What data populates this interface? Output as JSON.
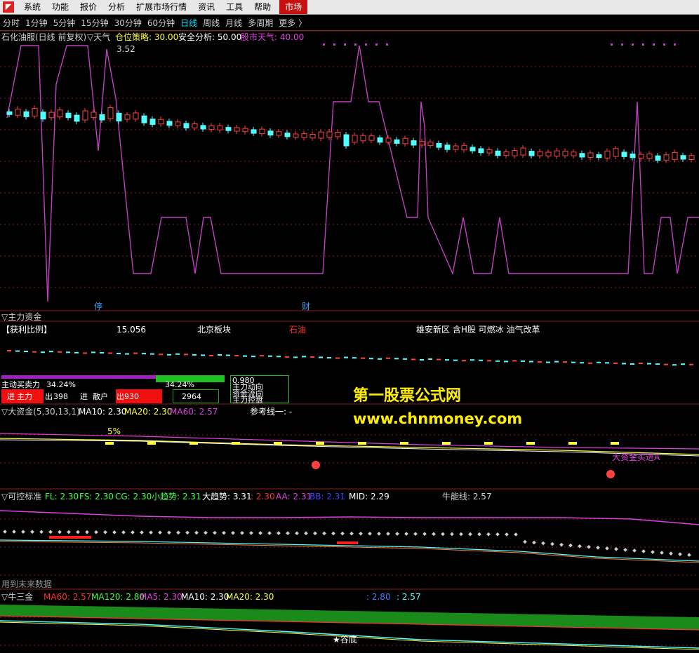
{
  "menu": {
    "items": [
      "系统",
      "功能",
      "报价",
      "分析",
      "扩展市场行情",
      "资讯",
      "工具",
      "帮助"
    ],
    "market": "市场"
  },
  "periods": [
    "分时",
    "1分钟",
    "5分钟",
    "15分钟",
    "30分钟",
    "60分钟",
    "日线",
    "周线",
    "月线",
    "多周期",
    "更多 〉"
  ],
  "active_period": "日线",
  "main_panel": {
    "title": "石化油服(日线 前复权)",
    "ind_name": "▽天气",
    "cang": "仓位策略: 30.00",
    "anquan": "安全分析: 50.00",
    "gushi": "股市天气: 40.00",
    "high_label": "3.52",
    "mark_a": "停",
    "mark_b": "财"
  },
  "zhuli_panel": {
    "title": "▽主力资金",
    "huoli": "【获利比例】",
    "huoli_val": "15.056",
    "bankuai": "北京板块",
    "hangye": "石油",
    "gainian": "雄安新区 含H股 可燃冰 油气改革",
    "maimai_label": "主动买卖力",
    "maimai_val": "34.24%",
    "maimai_val2": "34.24%",
    "row1_a": "进",
    "row1_b": "主力",
    "row1_c": "出",
    "row1_d": "398",
    "row2_a": "进",
    "row2_b": "散户",
    "row2_c": "出",
    "row2_d": "930",
    "row3_val": "2964",
    "ratio_top": "0.980",
    "right_rows": [
      "主力动向",
      "资金流向",
      "主力控盘"
    ]
  },
  "dazijin_panel": {
    "title": "▽大资金(5,30,13,1)",
    "ma10": "MA10: 2.30",
    "ma20": "MA20: 2.30",
    "ma60": "MA60: 2.57",
    "cankao": "参考线一: -",
    "pct": "5%",
    "signal": "大资金买进A"
  },
  "kekong_panel": {
    "title": "▽可控标准",
    "fl": "FL: 2.30",
    "fs": "FS: 2.30",
    "cg": "CG: 2.30",
    "xiao": "小趋势: 2.31",
    "da": "大趋势: 3.31",
    "v1": ": 2.30",
    "aa": "AA: 2.31",
    "bb": "BB: 2.31",
    "mid": "MID: 2.29",
    "niuneng": "牛能线: 2.57",
    "future": "用到未来数据"
  },
  "niusanjin_panel": {
    "title": "▽牛三金",
    "ma60": "MA60: 2.57",
    "ma120": "MA120: 2.80",
    "ma5": "MA5: 2.30",
    "ma10": "MA10: 2.30",
    "ma20": "MA20: 2.30",
    "v1": ": 2.80",
    "v2": ": 2.57",
    "gudi": "★谷底"
  },
  "watermark": {
    "line1": "第一股票公式网",
    "line2": "www.chnmoney.com"
  },
  "colors": {
    "up": "#ff4040",
    "down": "#54ffff",
    "purple": "#c040c0",
    "grid": "#8a1e1e"
  }
}
